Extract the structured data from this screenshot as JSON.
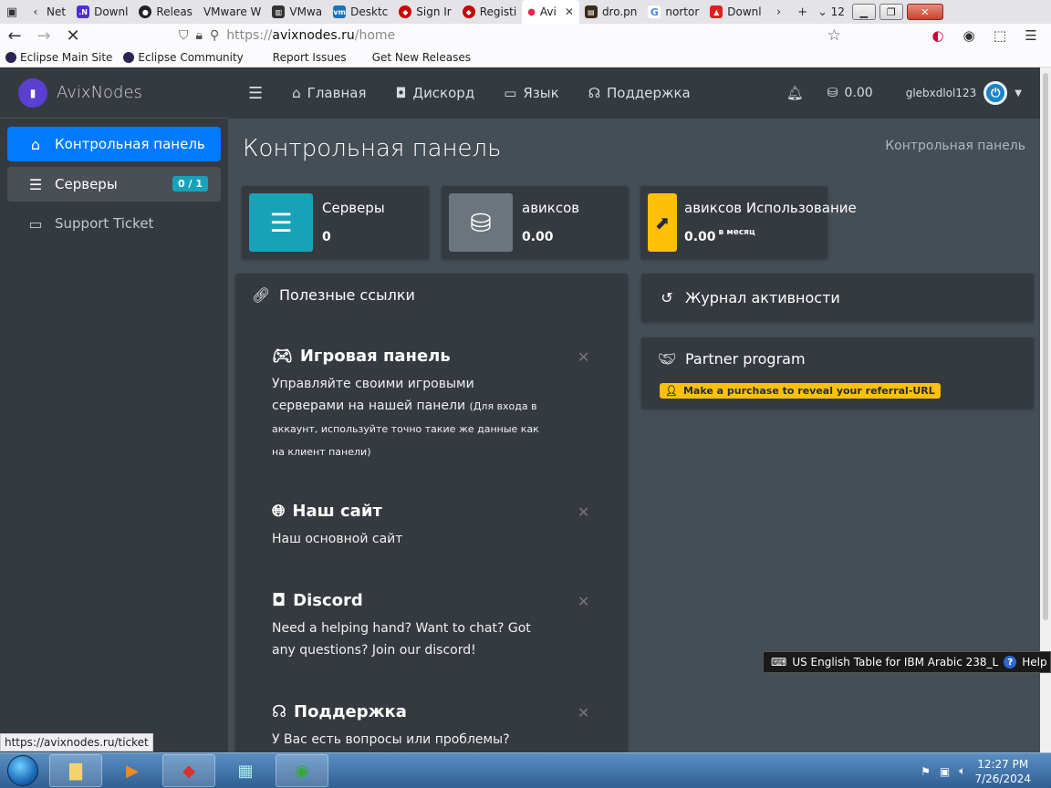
{
  "browser": {
    "tabs": [
      {
        "label": "Net",
        "icon": "back-arrow-icon",
        "color": "#888888",
        "close": ""
      },
      {
        "label": "Downl",
        "icon": "dnet-icon",
        "color": "#512bd4",
        "close": ""
      },
      {
        "label": "Releas",
        "icon": "github-icon",
        "color": "#222222",
        "close": ""
      },
      {
        "label": "VMware W",
        "icon": "vmware-icon",
        "color": "#ffffff",
        "close": ""
      },
      {
        "label": "VMwa",
        "icon": "imdb-like-icon",
        "color": "#333333",
        "close": ""
      },
      {
        "label": "Desktc",
        "icon": "vmware-desktop-icon",
        "color": "#1d72b8",
        "close": ""
      },
      {
        "label": "Sign Ir",
        "icon": "redhat-icon",
        "color": "#cc0000",
        "close": ""
      },
      {
        "label": "Registi",
        "icon": "redhat-icon",
        "color": "#cc0000",
        "close": ""
      },
      {
        "label": "Avi",
        "icon": "loading-dot-icon",
        "color": "#e22850",
        "close": "✕",
        "active": true
      },
      {
        "label": "dro.pn",
        "icon": "image-icon",
        "color": "#3a2a1a",
        "close": ""
      },
      {
        "label": "nortor",
        "icon": "google-icon",
        "color": "#4285f4",
        "close": ""
      },
      {
        "label": "Downl",
        "icon": "pdf-icon",
        "color": "#e02020",
        "close": ""
      }
    ],
    "tab_count": "12",
    "url_scheme": "https://",
    "url_host": "avixnodes.ru",
    "url_path": "/home",
    "bookmarks": [
      "Eclipse Main Site",
      "Eclipse Community",
      "Report Issues",
      "Get New Releases"
    ],
    "status_url": "https://avixnodes.ru/ticket"
  },
  "site": {
    "brand": "AvixNodes",
    "sidebar": [
      {
        "label": "Контрольная панель",
        "icon": "home-icon"
      },
      {
        "label": "Серверы",
        "icon": "server-icon",
        "badge": "0 / 1"
      },
      {
        "label": "Support Ticket",
        "icon": "ticket-icon"
      }
    ],
    "topnav": [
      {
        "label": "Главная",
        "icon": "home-icon"
      },
      {
        "label": "Дискорд",
        "icon": "discord-icon"
      },
      {
        "label": "Язык",
        "icon": "language-icon"
      },
      {
        "label": "Поддержка",
        "icon": "headset-icon"
      }
    ],
    "balance": "0.00",
    "username": "glebxdlol123",
    "page_title": "Контрольная панель",
    "breadcrumb": "Контрольная панель",
    "info_boxes": [
      {
        "label": "Серверы",
        "value": "0",
        "suffix": "",
        "color": "#17a2b8",
        "icon": "server-icon"
      },
      {
        "label": "авиксов",
        "value": "0.00",
        "suffix": "",
        "color": "#6c757d",
        "icon": "coins-icon"
      },
      {
        "label": "авиксов Использование",
        "value": "0.00",
        "suffix": "в месяц",
        "color": "#ffc107",
        "icon": "chart-line-icon"
      }
    ],
    "useful_links": {
      "title": "Полезные ссылки",
      "items": [
        {
          "title": "Игровая панель",
          "text": "Управляйте своими игровыми серверами на нашей панели",
          "note": "(Для входа в аккаунт, используйте точно такие же данные как на клиент панели)"
        },
        {
          "title": "Наш сайт",
          "text": "Наш основной сайт",
          "note": ""
        },
        {
          "title": "Discord",
          "text": "Need a helping hand? Want to chat? Got any questions? Join our discord!",
          "note": ""
        },
        {
          "title": "Поддержка",
          "text": "У Вас есть вопросы или проблемы?",
          "note": ""
        }
      ]
    },
    "activity_log": {
      "title": "Журнал активности"
    },
    "partner": {
      "title": "Partner program",
      "badge": "Make a purchase to reveal your referral-URL"
    }
  },
  "os": {
    "language_bar": "US English Table for IBM Arabic 238_L",
    "help": "Help",
    "time": "12:27 PM",
    "date": "7/26/2024"
  }
}
